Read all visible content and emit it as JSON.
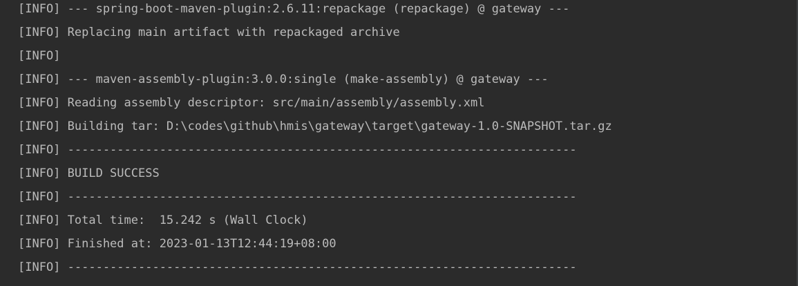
{
  "console": {
    "lines": [
      "[INFO] --- spring-boot-maven-plugin:2.6.11:repackage (repackage) @ gateway ---",
      "[INFO] Replacing main artifact with repackaged archive",
      "[INFO]",
      "[INFO] --- maven-assembly-plugin:3.0.0:single (make-assembly) @ gateway ---",
      "[INFO] Reading assembly descriptor: src/main/assembly/assembly.xml",
      "[INFO] Building tar: D:\\codes\\github\\hmis\\gateway\\target\\gateway-1.0-SNAPSHOT.tar.gz",
      "[INFO] ------------------------------------------------------------------------",
      "[INFO] BUILD SUCCESS",
      "[INFO] ------------------------------------------------------------------------",
      "[INFO] Total time:  15.242 s (Wall Clock)",
      "[INFO] Finished at: 2023-01-13T12:44:19+08:00",
      "[INFO] ------------------------------------------------------------------------"
    ]
  },
  "colors": {
    "background": "#2b2b2b",
    "text": "#bbbbbb"
  }
}
